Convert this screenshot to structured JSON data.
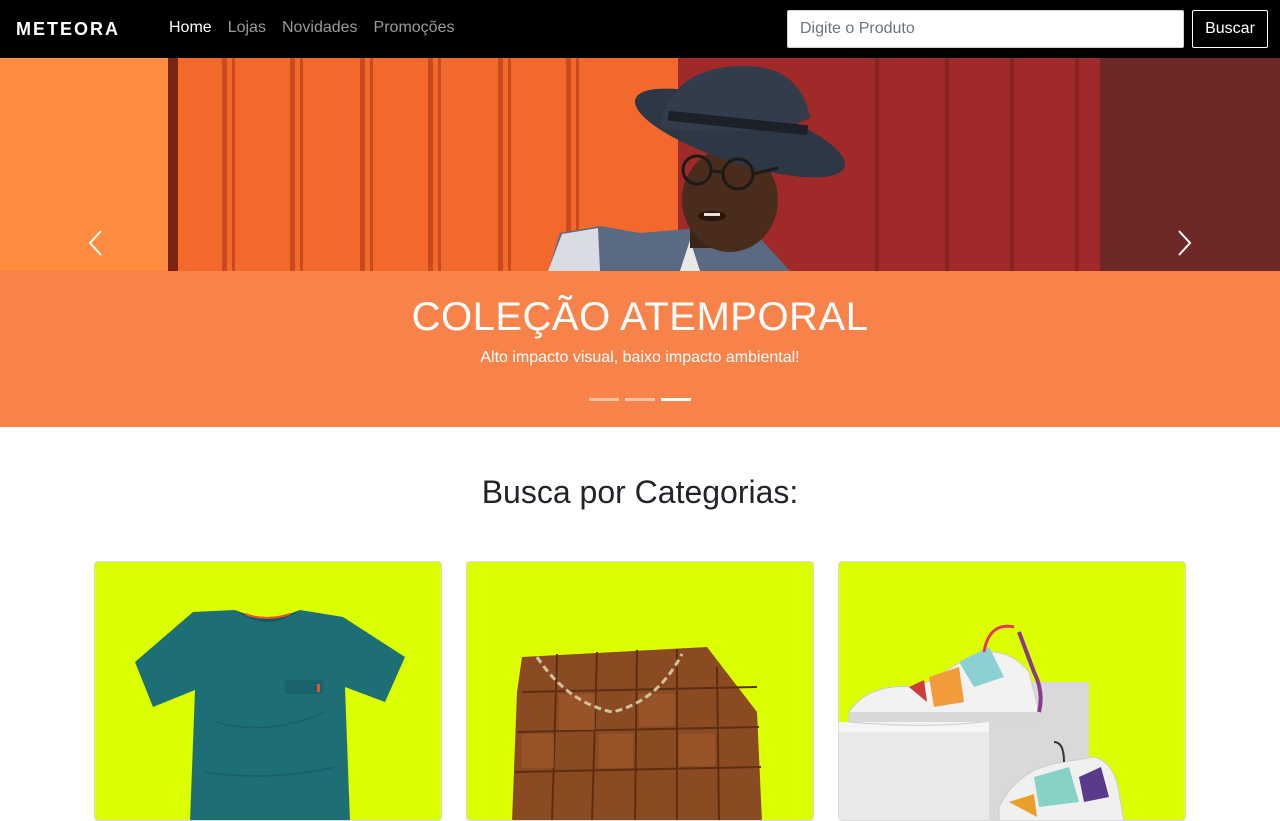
{
  "brand": {
    "logo_text": "METEORA"
  },
  "nav": {
    "links": [
      {
        "label": "Home",
        "active": true
      },
      {
        "label": "Lojas",
        "active": false
      },
      {
        "label": "Novidades",
        "active": false
      },
      {
        "label": "Promoções",
        "active": false
      }
    ]
  },
  "search": {
    "placeholder": "Digite o Produto",
    "value": "",
    "button_label": "Buscar"
  },
  "hero": {
    "title": "COLEÇÃO ATEMPORAL",
    "subtitle": "Alto impacto visual, baixo impacto ambiental!",
    "slide_count": 3,
    "active_slide": 3,
    "prev_icon": "chevron-left-icon",
    "next_icon": "chevron-right-icon"
  },
  "categories": {
    "title": "Busca por Categorias:",
    "items": [
      {
        "image": "teal-tshirt"
      },
      {
        "image": "brown-woven-bag"
      },
      {
        "image": "sneakers"
      }
    ]
  },
  "colors": {
    "navbar": "#000000",
    "hero_caption_bg": "#f8834a",
    "card_bg": "#dcff00",
    "logo_accent": "#e9ff00"
  }
}
